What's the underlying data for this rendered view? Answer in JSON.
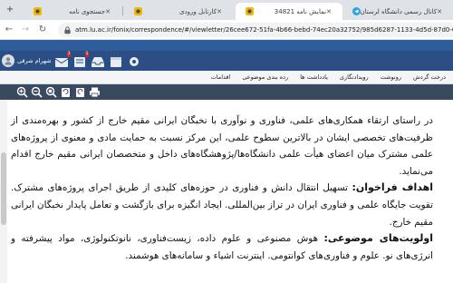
{
  "browser": {
    "tabs": [
      {
        "title": "کانال رسمی دانشگاه لرستان",
        "active": false
      },
      {
        "title": "نمایش نامه 34821",
        "active": true
      },
      {
        "title": "کارتابل ورودی",
        "active": false
      },
      {
        "title": "جستجوی نامه",
        "active": false
      }
    ],
    "address_url": "atm.lu.ac.ir/fonix/correspondence/#/viewletter/26cee672-51fa-4b66-bebd-74ec20a32752/985d6287-1133-4d5d-87d0-09d7c8731d69"
  },
  "app": {
    "user_name": "شهرام شرقی",
    "badge_counts": [
      "3",
      "1"
    ],
    "menu": [
      "درخت گردش",
      "رونوشت",
      "رویدادنگاری",
      "یادداشت ها",
      "رده بندی موضوعی",
      "اقدامات"
    ]
  },
  "document": {
    "para1": "در راستای ارتقاء همکاری‌های علمی، فناوری و نوآوری با نخبگان ایرانی مقیم خارج از کشور و بهره‌مندی از ظرفیت‌های تخصصی ایشان در بالاترین سطوح علمی، این مرکز نسبت به حمایت مادی و معنوی از پروژه‌های علمی مشترک میان اعضای هیأت علمی دانشگاه‌ها/پژوهشگاه‌های داخل و متخصصان ایرانی مقیم خارج اقدام می‌نماید.",
    "goal_label": "اهداف فراخوان:",
    "goal_text": " تسهیل انتقال دانش و فناوری در حوزه‌های کلیدی از طریق اجرای پروژه‌های مشترک. تقویت جایگاه علمی و فناوری ایران در تراز بین‌المللی. ایجاد انگیزه برای بازگشت و تعامل پایدار نخبگان ایرانی مقیم خارج.",
    "priority_label": "اولویت‌های موضوعی:",
    "priority_text": " هوش مصنوعی و علوم داده، زیست‌فناوری، نانوتکنولوژی، مواد پیشرفته و انرژی‌های نو. علوم و فناوری‌های کوانتومی. اینترنت اشیاء و سامانه‌های هوشمند."
  }
}
